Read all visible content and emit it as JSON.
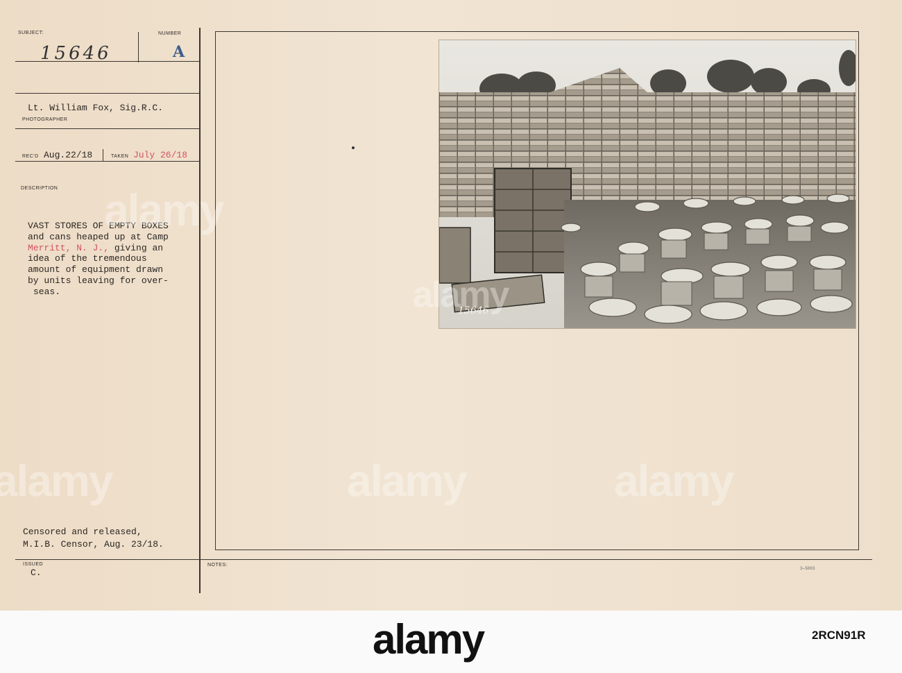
{
  "card": {
    "labels": {
      "subject": "SUBJECT:",
      "number": "NUMBER",
      "photographer": "PHOTOGRAPHER",
      "recd": "REC'D",
      "taken": "TAKEN",
      "description": "DESCRIPTION",
      "issued": "ISSUED",
      "notes": "NOTES:"
    },
    "subject_number": "15646",
    "number_letter": "A",
    "photographer_name": "Lt. William Fox, Sig.R.C.",
    "recd_date": "Aug.22/18",
    "taken_date": "July 26/18",
    "description_lines": [
      "VAST STORES OF EMPTY BOXES",
      "and cans heaped up at Camp",
      "Merritt, N. J., giving an",
      "idea of the tremendous",
      "amount of equipment drawn",
      "by units leaving for over-",
      "seas."
    ],
    "description_red": "Merritt, N. J.,",
    "censor_lines": [
      "Censored and released,",
      "M.I.B. Censor, Aug. 23/18."
    ],
    "issued_value": "C.",
    "form_code": "3—5003",
    "photo_negative_number": "15646"
  },
  "watermark": "alamy",
  "footer": {
    "logo": "alamy",
    "image_id": "2RCN91R"
  },
  "colors": {
    "card": "#efe1ce",
    "ink": "#2a2622",
    "red_ink": "#d3525e",
    "blue_stamp": "#3c5d8a"
  }
}
